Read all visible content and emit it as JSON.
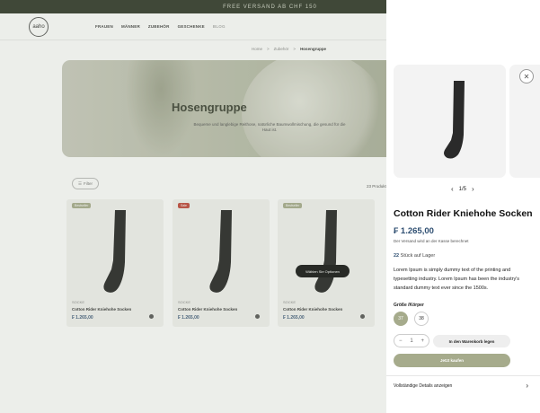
{
  "promo": "FREE VERSAND AB CHF 150",
  "logo": "aaho",
  "nav": [
    "FRAUEN",
    "MÄNNER",
    "ZUBEHÖR",
    "GESCHENKE",
    "BLOG"
  ],
  "breadcrumb": {
    "home": "Home",
    "sep1": ">",
    "level2": "Zubehör",
    "sep2": ">",
    "current": "Hosengruppe"
  },
  "hero": {
    "title": "Hosengruppe",
    "subtitle": "Bequeme und langlebige Reithose, natürliche Baumwollmischung, die gesund für die Haut ist."
  },
  "listing": {
    "filter_label": "Filter",
    "count": "23 Produkte",
    "quick_add_label": "Wählen Sie Optionen"
  },
  "cards": [
    {
      "tag": "Bestseller",
      "tag_color": "#a6ab8c",
      "brand": "SOCKE",
      "name": "Cotton Rider Kniehohe Socken",
      "price": "₣ 1.265,00"
    },
    {
      "tag": "Sale",
      "tag_color": "#c0463a",
      "brand": "SOCKE",
      "name": "Cotton Rider Kniehohe Socken",
      "price": "₣ 1.265,00"
    },
    {
      "tag": "Bestseller",
      "tag_color": "#a6ab8c",
      "brand": "SOCKE",
      "name": "Cotton Rider Kniehohe Socken",
      "price": "₣ 1.265,00"
    }
  ],
  "drawer": {
    "close_icon": "close-icon",
    "pager": {
      "current": "1/5",
      "prev_icon": "chevron-left-icon",
      "next_icon": "chevron-right-icon"
    },
    "title": "Cotton Rider Kniehohe Socken",
    "price": "₣ 1.265,00",
    "shipping": "Der Versand wird an der Kasse berechnet",
    "stock_count": "22",
    "stock_text": " Stück auf Lager",
    "description": "Lorem Ipsum is simply dummy text of the printing and typesetting industry. Lorem Ipsum has been the industry's standard dummy text ever since the 1500s.",
    "size_label": "Größe /Körper",
    "sizes": [
      "37",
      "38"
    ],
    "selected_size": "37",
    "qty": {
      "minus": "−",
      "value": "1",
      "plus": "+"
    },
    "add_to_cart": "In den Warenkorb legen",
    "buy_now": "Jetzt kaufen",
    "details_link": "Vollständige Details anzeigen",
    "accent_color": "#a6ab8c",
    "price_color": "#2f4f72"
  }
}
